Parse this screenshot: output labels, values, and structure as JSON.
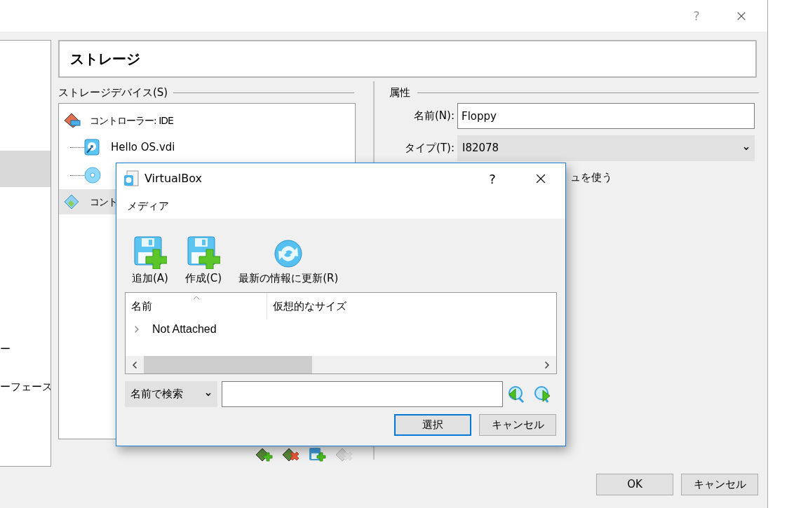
{
  "window": {
    "help": "?"
  },
  "sidebar": {
    "items": [
      {
        "selected": true
      },
      {
        "label": "ー",
        "selected": false
      },
      {
        "label": "ーフェース",
        "selected": false
      }
    ]
  },
  "page": {
    "title": "ストレージ"
  },
  "storage_devices": {
    "label": "ストレージデバイス(S)",
    "tree": [
      {
        "kind": "controller",
        "label": "コントローラー: IDE",
        "selected": false,
        "children": [
          {
            "kind": "disk",
            "label": "Hello OS.vdi"
          },
          {
            "kind": "optical"
          }
        ]
      },
      {
        "kind": "floppy_controller",
        "label": "コント",
        "selected": true
      }
    ],
    "toolbar": [
      {
        "kind": "add_controller",
        "disabled": false
      },
      {
        "kind": "remove_controller",
        "disabled": false
      },
      {
        "kind": "add_attachment",
        "disabled": false
      },
      {
        "kind": "remove_attachment",
        "disabled": true
      }
    ]
  },
  "attributes": {
    "label": "属性",
    "name": {
      "label": "名前(N):",
      "value": "Floppy"
    },
    "type": {
      "label": "タイプ(T):",
      "value": "I82078"
    },
    "cache": {
      "label": "ュを使う"
    }
  },
  "buttons": [
    "OK",
    "キャンセル"
  ],
  "dialog": {
    "title": "VirtualBox",
    "help": "?",
    "menu": [
      "メディア"
    ],
    "toolbar": [
      {
        "kind": "add",
        "label": "追加(A)"
      },
      {
        "kind": "create",
        "label": "作成(C)"
      },
      {
        "kind": "refresh",
        "label": "最新の情報に更新(R)"
      }
    ],
    "table": {
      "columns": [
        {
          "label": "名前",
          "sorted": true
        },
        {
          "label": "仮想的なサイズ",
          "sorted": false
        }
      ],
      "rows": [
        {
          "name": "Not Attached",
          "expanded": false
        }
      ]
    },
    "search": {
      "mode": "名前で検索"
    },
    "buttons": [
      {
        "label": "選択",
        "default": true
      },
      {
        "label": "キャンセル",
        "default": false
      }
    ]
  }
}
